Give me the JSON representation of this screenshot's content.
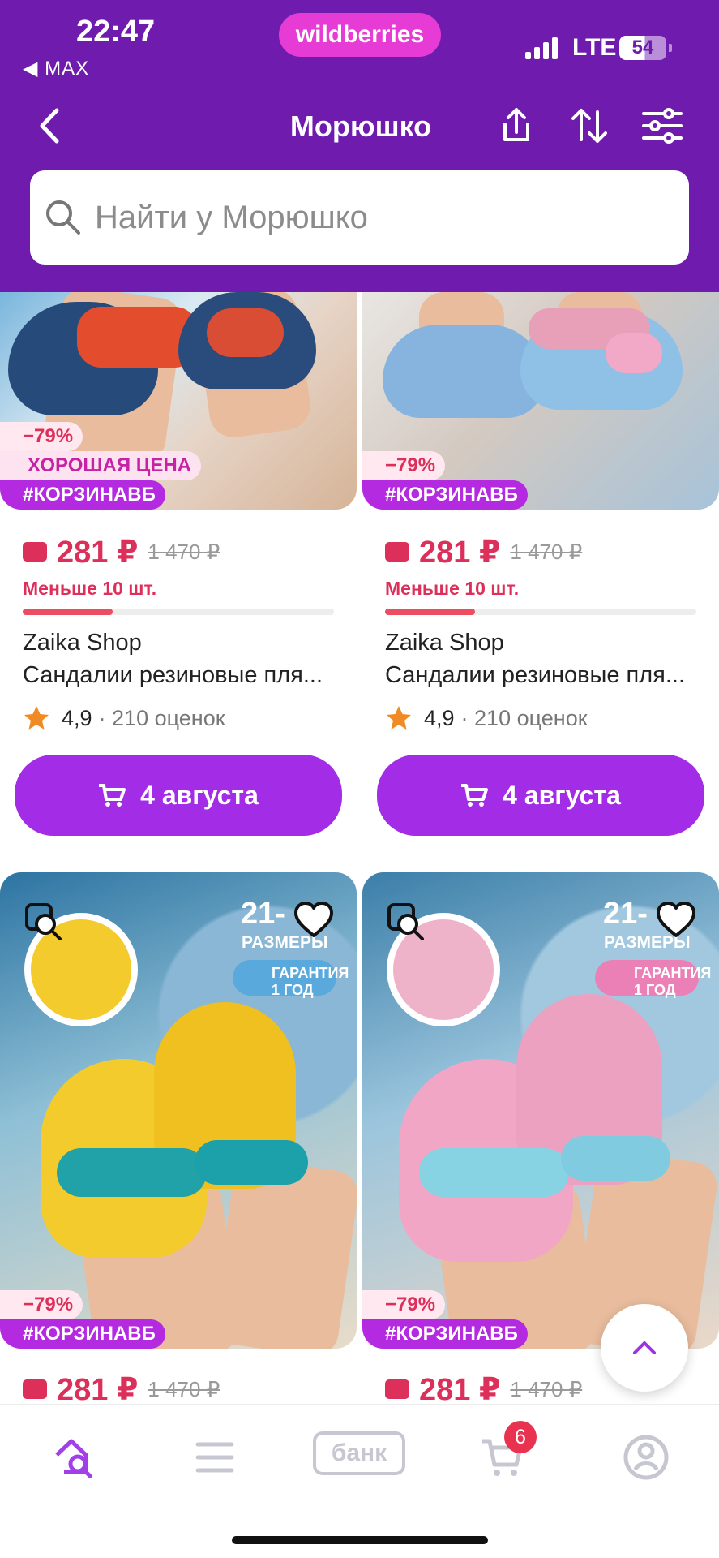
{
  "status_bar": {
    "time": "22:47",
    "back_app": "◀ MAX",
    "brand": "wildberries",
    "network": "LTE",
    "battery": "54"
  },
  "header": {
    "title": "Морюшко"
  },
  "search": {
    "placeholder": "Найти у Морюшко"
  },
  "products": [
    {
      "discount": "−79%",
      "good_price": "ХОРОШАЯ ЦЕНА",
      "tag": "#КОРЗИНАВБ",
      "price": "281 ₽",
      "old_price": "1 470 ₽",
      "stock": "Меньше 10 шт.",
      "stock_level": 0.29,
      "seller": "Zaika Shop",
      "name": "Сандалии резиновые пля...",
      "rating": "4,9",
      "rating_count": "· 210 оценок",
      "delivery": "4 августа"
    },
    {
      "discount": "−79%",
      "tag": "#КОРЗИНАВБ",
      "price": "281 ₽",
      "old_price": "1 470 ₽",
      "stock": "Меньше 10 шт.",
      "stock_level": 0.29,
      "seller": "Zaika Shop",
      "name": "Сандалии резиновые пля...",
      "rating": "4,9",
      "rating_count": "· 210 оценок",
      "delivery": "4 августа"
    },
    {
      "discount": "−79%",
      "tag": "#КОРЗИНАВБ",
      "price": "281 ₽",
      "old_price": "1 470 ₽",
      "sticker_size": "21-",
      "sticker_sizes": "РАЗМЕРЫ",
      "sticker_warranty": "ГАРАНТИЯ 1 ГОД"
    },
    {
      "discount": "−79%",
      "tag": "#КОРЗИНАВБ",
      "price": "281 ₽",
      "old_price": "1 470 ₽",
      "sticker_size": "21-",
      "sticker_sizes": "РАЗМЕРЫ",
      "sticker_warranty": "ГАРАНТИЯ 1 ГОД"
    }
  ],
  "bottom_nav": {
    "bank_label": "банк",
    "cart_count": "6"
  },
  "colors": {
    "header": "#6f1cae",
    "brand": "#e63bd4",
    "accent": "#a32ce7",
    "price": "#dc2f5a"
  }
}
